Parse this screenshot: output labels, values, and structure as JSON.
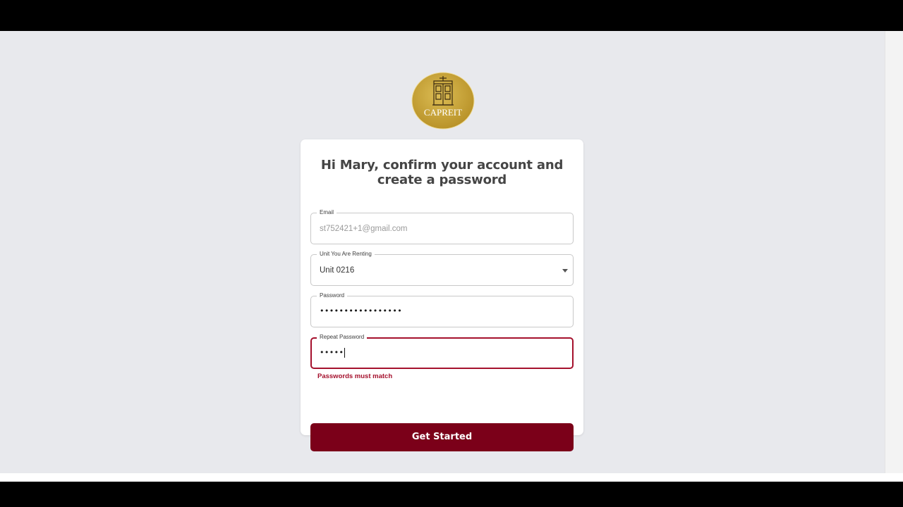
{
  "brand": {
    "logo_text": "CAPREIT",
    "logo_color": "#c9a43a"
  },
  "form": {
    "title": "Hi Mary, confirm your account and create a password",
    "email": {
      "label": "Email",
      "value": "st752421+1@gmail.com"
    },
    "unit": {
      "label": "Unit You Are Renting",
      "selected": "Unit 0216"
    },
    "password": {
      "label": "Password",
      "masked_value": "•••••••••••••••••"
    },
    "repeat_password": {
      "label": "Repeat Password",
      "masked_value": "•••••"
    },
    "error_message": "Passwords must match",
    "submit_label": "Get Started"
  },
  "colors": {
    "accent": "#7b0019",
    "error": "#a5112d",
    "page_background": "#e8e9ed"
  }
}
